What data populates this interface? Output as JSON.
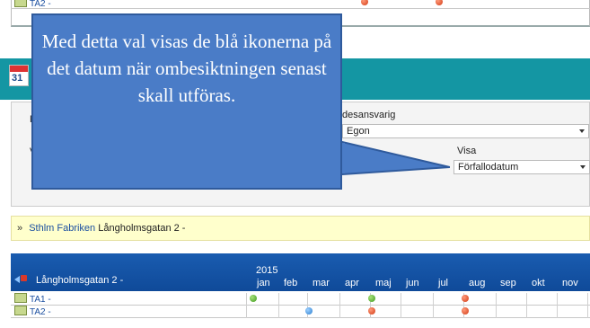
{
  "prev_table": {
    "row_label": "TA2 -"
  },
  "app": {
    "calendar_day": "31"
  },
  "filters": {
    "label_partial_1": "F",
    "label_partial_2": "V",
    "responsible_label": "desansvarig",
    "responsible_value": "Egon",
    "show_label": "Visa",
    "show_value": "Förfallodatum"
  },
  "breadcrumb": {
    "separator": "»",
    "link": "Sthlm Fabriken",
    "current": "Långholmsgatan 2 -"
  },
  "timeline": {
    "site": "Långholmsgatan 2 -",
    "year": "2015",
    "months": [
      "jan",
      "feb",
      "mar",
      "apr",
      "maj",
      "jun",
      "jul",
      "aug",
      "sep",
      "okt",
      "nov"
    ],
    "rows": [
      {
        "label": "TA1 -",
        "markers": [
          {
            "month": "jan",
            "status": "green"
          },
          {
            "month": "maj",
            "status": "green"
          },
          {
            "month": "aug",
            "status": "red"
          }
        ]
      },
      {
        "label": "TA2 -",
        "markers": [
          {
            "month": "mar",
            "status": "blue"
          },
          {
            "month": "maj",
            "status": "red"
          },
          {
            "month": "aug",
            "status": "red"
          }
        ]
      }
    ]
  },
  "callout": {
    "text": "Med detta val visas de blå ikonerna på det datum när ombesiktningen senast skall utföras."
  },
  "colors": {
    "header_teal": "#1496a3",
    "timeline_blue": "#1a5cb0",
    "callout_blue": "#4a7cc7"
  }
}
